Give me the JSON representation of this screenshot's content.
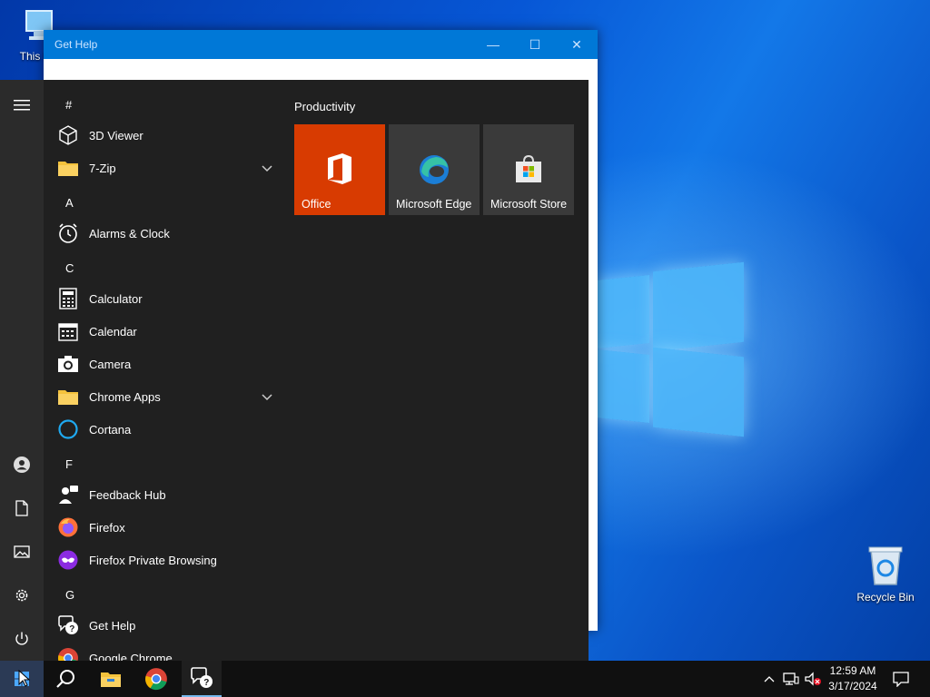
{
  "desktop": {
    "icons": [
      {
        "label": "This PC",
        "icon": "this-pc-icon"
      },
      {
        "label": "Recycle Bin",
        "icon": "recycle-bin-icon"
      }
    ]
  },
  "window": {
    "title": "Get Help",
    "minimize": "—",
    "maximize": "☐",
    "close": "✕"
  },
  "start_menu": {
    "tiles_group": "Productivity",
    "tiles": [
      {
        "label": "Office",
        "color": "#d83b01"
      },
      {
        "label": "Microsoft Edge",
        "color": "#3a3a3a"
      },
      {
        "label": "Microsoft Store",
        "color": "#3a3a3a"
      }
    ],
    "sections": {
      "hash": "#",
      "a": "A",
      "c": "C",
      "f": "F",
      "g": "G"
    },
    "apps": {
      "viewer3d": "3D Viewer",
      "zip": "7-Zip",
      "alarms": "Alarms & Clock",
      "calculator": "Calculator",
      "calendar": "Calendar",
      "camera": "Camera",
      "chrome_apps": "Chrome Apps",
      "cortana": "Cortana",
      "feedback": "Feedback Hub",
      "firefox": "Firefox",
      "firefox_private": "Firefox Private Browsing",
      "gethelp": "Get Help",
      "chrome": "Google Chrome"
    }
  },
  "taskbar": {
    "time": "12:59 AM",
    "date": "3/17/2024"
  },
  "colors": {
    "accent": "#0078d7",
    "start_bg": "#202020",
    "rail_bg": "#2b2b2b",
    "taskbar_bg": "#101010"
  }
}
